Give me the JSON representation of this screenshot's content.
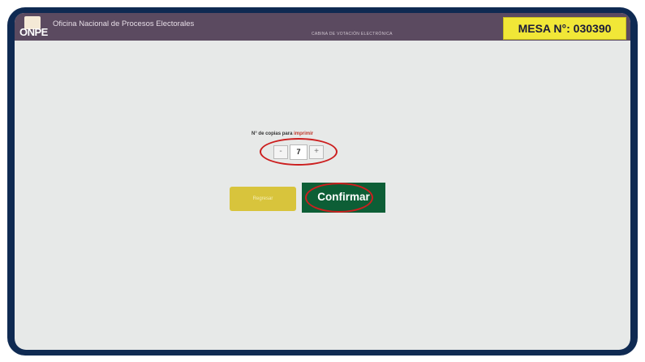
{
  "header": {
    "logo_text": "ONPE",
    "org_name": "Oficina Nacional de Procesos Electorales",
    "center_caption": "CABINA DE VOTACIÓN ELECTRÓNICA",
    "mesa_label": "MESA N°: 030390"
  },
  "copies": {
    "label_prefix": "N° de copias para",
    "label_accent": "imprimir",
    "decrement_label": "-",
    "value": "7",
    "increment_label": "+"
  },
  "actions": {
    "back_label": "Regresar",
    "confirm_label": "Confirmar"
  },
  "colors": {
    "frame": "#0f2a52",
    "header": "#5b4a60",
    "badge": "#f1e737",
    "confirm": "#0d5e36",
    "back": "#d8c43c",
    "highlight_ring": "#cc1f1f"
  }
}
